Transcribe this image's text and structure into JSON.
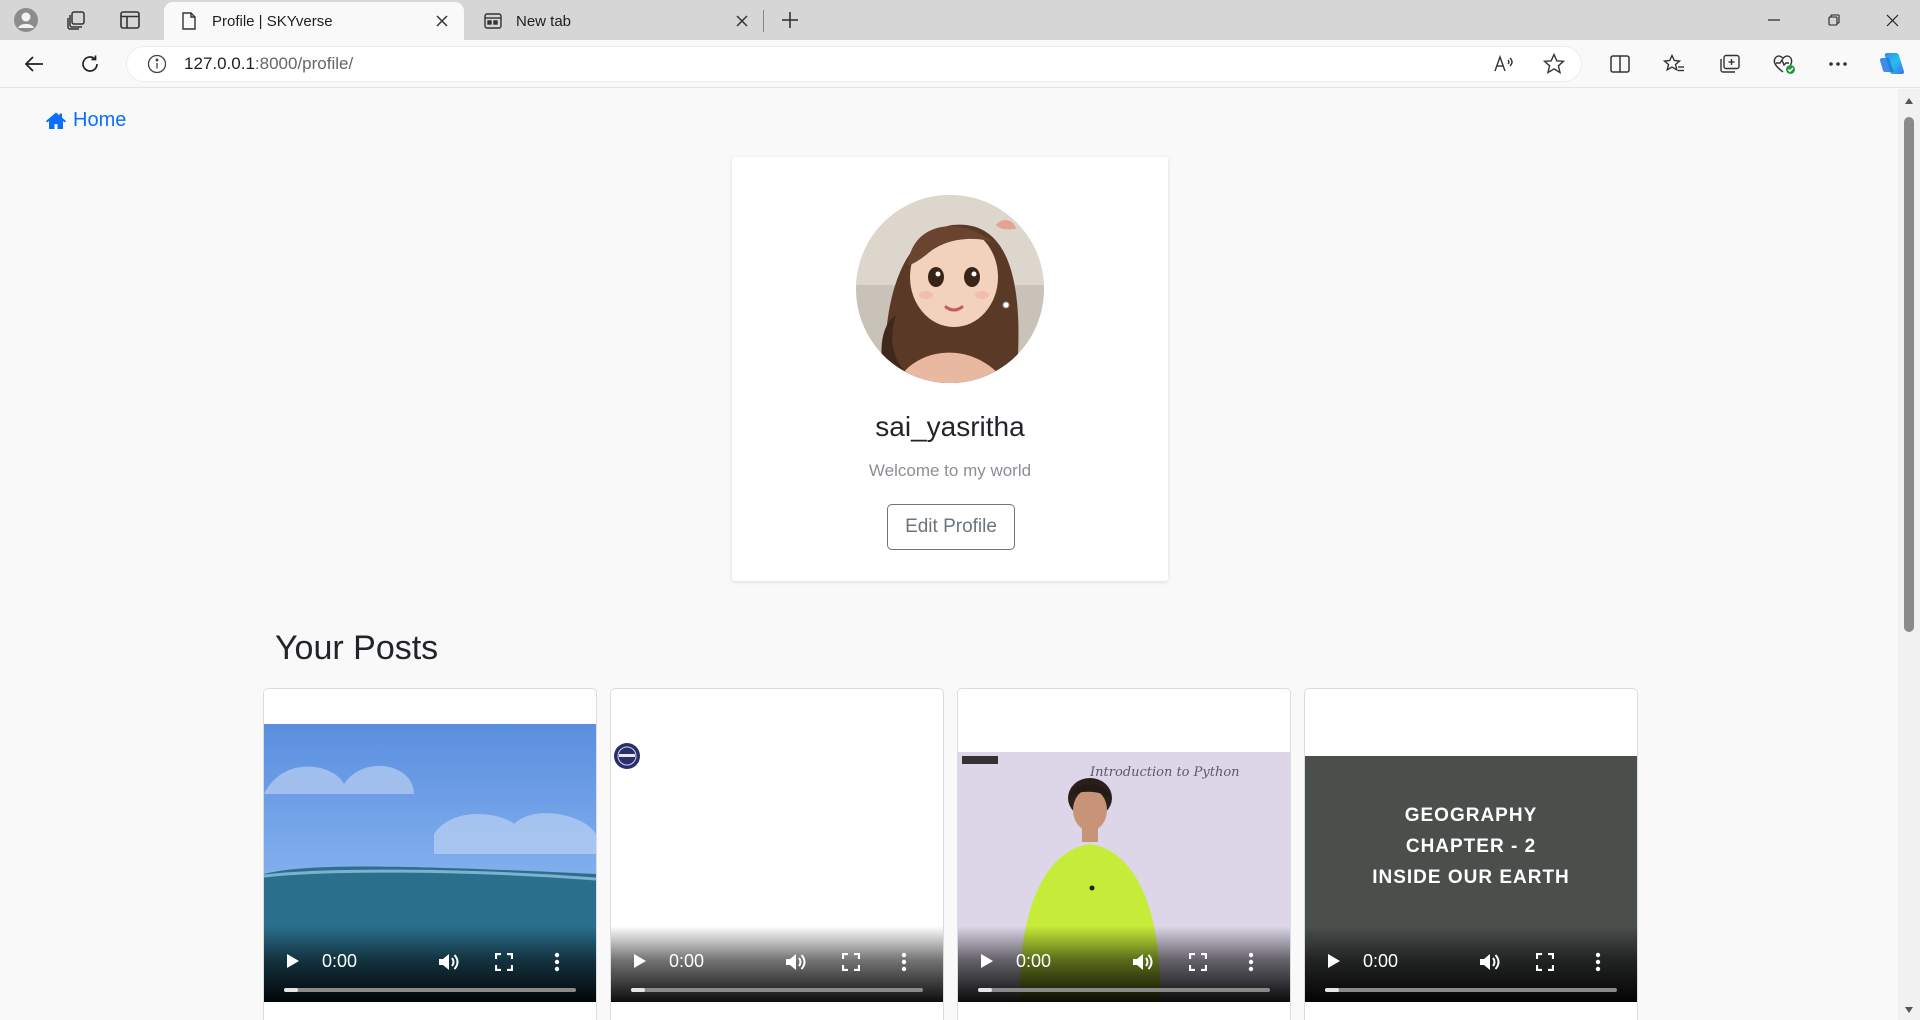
{
  "browser": {
    "tabs": [
      {
        "title": "Profile | SKYverse",
        "active": true
      },
      {
        "title": "New tab",
        "active": false
      }
    ],
    "url_host": "127.0.0.1",
    "url_rest": ":8000/profile/"
  },
  "nav": {
    "home_label": "Home"
  },
  "profile": {
    "username": "sai_yasritha",
    "bio": "Welcome to my world",
    "edit_button": "Edit Profile"
  },
  "posts": {
    "heading": "Your Posts",
    "items": [
      {
        "time": "0:00",
        "progress": 0.0
      },
      {
        "time": "0:00",
        "progress": 0.0
      },
      {
        "time": "0:00",
        "progress": 0.0
      },
      {
        "time": "0:00",
        "progress": 0.0,
        "title_lines": [
          "GEOGRAPHY",
          "CHAPTER - 2",
          "INSIDE OUR EARTH"
        ]
      }
    ],
    "third_board_text": "Introduction to Python"
  },
  "colors": {
    "link_blue": "#0d6efd",
    "titlebar": "#d6d6d6",
    "page_bg": "#f9f9f9"
  }
}
